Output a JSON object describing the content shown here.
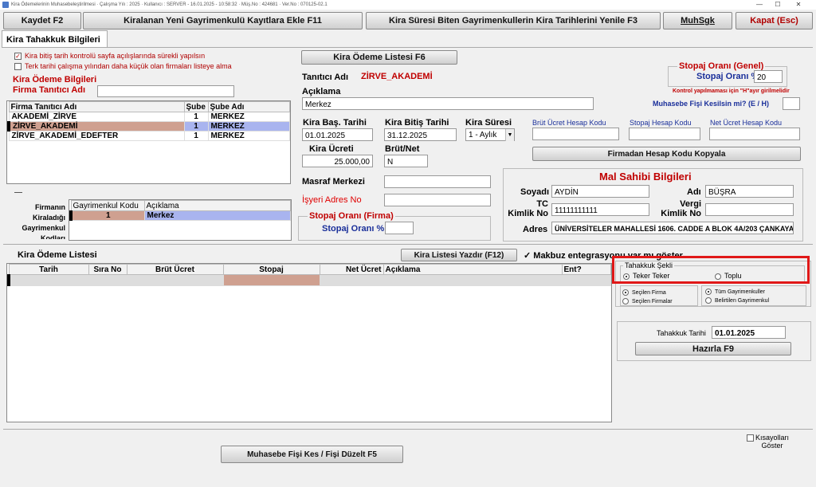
{
  "window": {
    "title": "Kira Ödemelerinin Muhasebeleştirilmesi   ·  Çalışma Yılı : 2025   ·  Kullanıcı : SERVER - 16.01.2025 - 10:58:32  ·  Müş.No : 424681  · Ver.No : 070125-02.1",
    "min": "—",
    "max": "☐",
    "close": "✕"
  },
  "toolbar": {
    "save": "Kaydet F2",
    "add_new": "Kiralanan Yeni Gayrimenkulü Kayıtlara Ekle F11",
    "renew": "Kira Süresi Biten Gayrimenkullerin Kira Tarihlerini Yenile F3",
    "muhsgk": "MuhSgk",
    "close": "Kapat (Esc)"
  },
  "tab": "Kira Tahakkuk Bilgileri",
  "left": {
    "chk1": "Kira bitiş tarih kontrolü sayfa açılışlarında sürekli yapılsın",
    "chk2": "Terk tarihi çalışma yılından daha küçük olan firmaları listeye alma",
    "section": "Kira Ödeme Bilgileri",
    "firma_label": "Firma Tanıtıcı Adı",
    "firma_value": "",
    "cols": [
      "Firma Tanıtıcı Adı",
      "Şube",
      "Şube Adı"
    ],
    "rows": [
      {
        "name": "AKADEMİ_ZİRVE",
        "sube": "1",
        "subeadi": "MERKEZ"
      },
      {
        "name": "ZİRVE_AKADEMİ",
        "sube": "1",
        "subeadi": "MERKEZ"
      },
      {
        "name": "ZİRVE_AKADEMİ_EDEFTER",
        "sube": "1",
        "subeadi": "MERKEZ"
      }
    ],
    "gm_label": "Firmanın Kiraladığı Gayrimenkul Kodları",
    "gm_cols": [
      "Gayrimenkul Kodu",
      "Açıklama"
    ],
    "gm_rows": [
      {
        "kod": "1",
        "aciklama": "Merkez"
      }
    ]
  },
  "middle": {
    "list_btn": "Kira Ödeme Listesi F6",
    "tanitici_label": "Tanıtıcı Adı",
    "tanitici_value": "ZİRVE_AKADEMİ",
    "aciklama_label": "Açıklama",
    "aciklama_value": "Merkez",
    "bas_label": "Kira Baş. Tarihi",
    "bas_value": "01.01.2025",
    "bit_label": "Kira Bitiş Tarihi",
    "bit_value": "31.12.2025",
    "sure_label": "Kira Süresi",
    "sure_value": "1 - Aylık",
    "ucret_label": "Kira Ücreti",
    "ucret_value": "25.000,00",
    "brutnet_label": "Brüt/Net",
    "brutnet_value": "N",
    "masraf_label": "Masraf Merkezi",
    "isyeri_label": "İşyeri Adres No",
    "stopaj_firma_title": "Stopaj Oranı (Firma)",
    "stopaj_firma_label": "Stopaj Oranı %"
  },
  "right": {
    "stopaj_genel_title": "Stopaj Oranı (Genel)",
    "stopaj_genel_label": "Stopaj Oranı %",
    "stopaj_genel_value": "20",
    "kontrol_note": "Kontrol yapılmaması için \"H\"ayır girilmelidir",
    "muh_label": "Muhasebe Fişi Kesilsin mi? (E / H)",
    "brut_hk": "Brüt Ücret Hesap Kodu",
    "stopaj_hk": "Stopaj Hesap Kodu",
    "net_hk": "Net Ücret Hesap Kodu",
    "copy_btn": "Firmadan Hesap Kodu Kopyala",
    "owner_title": "Mal Sahibi Bilgileri",
    "soyadi_label": "Soyadı",
    "soyadi_value": "AYDİN",
    "adi_label": "Adı",
    "adi_value": "BÜŞRA",
    "tc_label": "TC\nKimlik No",
    "tc_value": "11111111111",
    "vergi_label": "Vergi\nKimlik No",
    "adres_label": "Adres",
    "adres_value": "ÜNİVERSİTELER MAHALLESİ 1606. CADDE A BLOK 4A/203 ÇANKAYA /"
  },
  "bottom": {
    "list_title": "Kira Ödeme Listesi",
    "print_btn": "Kira Listesi Yazdır (F12)",
    "makbuz": "Makbuz entegrasyonu var mı göster",
    "cols": [
      "Tarih",
      "Sıra No",
      "Brüt Ücret",
      "Stopaj",
      "Net Ücret",
      "Açıklama",
      "Ent?"
    ],
    "tahakkuk_title": "Tahakkuk Şekli",
    "teker": "Teker Teker",
    "toplu": "Toplu",
    "secilen_firma": "Seçilen Firma",
    "secilen_firmalar": "Seçilen Firmalar",
    "tum_gm": "Tüm Gayrimenkuller",
    "belirtilen_gm": "Belirtilen Gayrimenkul",
    "tarih_label": "Tahakkuk Tarihi",
    "tarih_value": "01.01.2025",
    "hazirla": "Hazırla F9",
    "muh_btn": "Muhasebe Fişi Kes / Fişi Düzelt F5",
    "kisayol": "Kısayolları\nGöster"
  }
}
